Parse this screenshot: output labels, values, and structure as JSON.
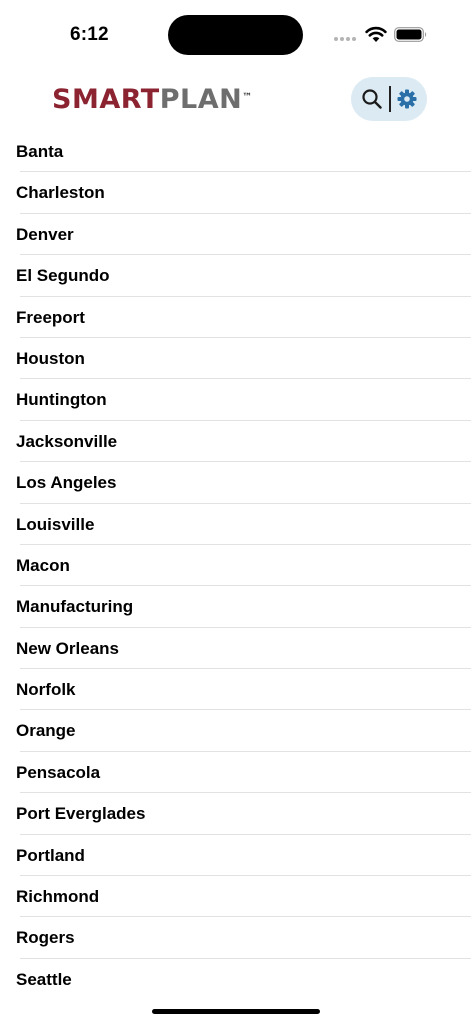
{
  "status_bar": {
    "time": "6:12"
  },
  "header": {
    "logo_primary": "SMART",
    "logo_secondary": "PLAN",
    "logo_trademark": "™",
    "search_icon": "search-icon",
    "settings_icon": "gear-icon"
  },
  "colors": {
    "logo_primary": "#8b2330",
    "logo_secondary": "#6e6e6e",
    "action_pill_bg": "#dbeaf3",
    "settings_accent": "#2a6fa8"
  },
  "locations": [
    "Banta",
    "Charleston",
    "Denver",
    "El Segundo",
    "Freeport",
    "Houston",
    "Huntington",
    "Jacksonville",
    "Los Angeles",
    "Louisville",
    "Macon",
    "Manufacturing",
    "New Orleans",
    "Norfolk",
    "Orange",
    "Pensacola",
    "Port Everglades",
    "Portland",
    "Richmond",
    "Rogers",
    "Seattle"
  ]
}
